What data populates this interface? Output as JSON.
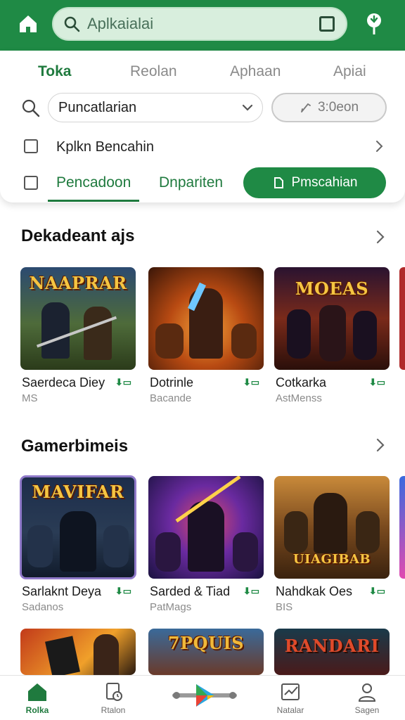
{
  "topbar": {
    "search_text": "Aplkaialai"
  },
  "tabs": [
    "Toka",
    "Reolan",
    "Aphaan",
    "Apiai"
  ],
  "filters": {
    "dropdown_value": "Puncatlarian",
    "time_value": "3:0eon",
    "checkbox_label": "Kplkn Bencahin",
    "link1": "Pencadoon",
    "link2": "Dnpariten",
    "button_label": "Pmscahian"
  },
  "sections": [
    {
      "title": "Dekadeant ajs",
      "games": [
        {
          "name": "Saerdeca Diey",
          "sub": "MS",
          "art": "NAAPRAR"
        },
        {
          "name": "Dotrinle",
          "sub": "Bacande",
          "art": ""
        },
        {
          "name": "Cotkarka",
          "sub": "AstMenss",
          "art": "MOEAS"
        }
      ]
    },
    {
      "title": "Gamerbimeis",
      "games": [
        {
          "name": "Sarlaknt Deya",
          "sub": "Sadanos",
          "art": "MAVIFAR"
        },
        {
          "name": "Sarded & Tiad",
          "sub": "PatMags",
          "art": ""
        },
        {
          "name": "Nahdkak Oes",
          "sub": "BIS",
          "art": "UIAGIBAB"
        }
      ]
    },
    {
      "games": [
        {
          "art": ""
        },
        {
          "art": "7PQUIS"
        },
        {
          "art": "RANDARI"
        }
      ]
    }
  ],
  "bottom_nav": [
    {
      "label": "Rolka",
      "icon": "home-icon",
      "active": true
    },
    {
      "label": "Rtalon",
      "icon": "document-clock-icon",
      "active": false
    },
    {
      "label": "",
      "icon": "play-store-icon",
      "active": false
    },
    {
      "label": "Natalar",
      "icon": "chart-card-icon",
      "active": false
    },
    {
      "label": "Sagen",
      "icon": "profile-icon",
      "active": false
    }
  ],
  "colors": {
    "brand_green": "#1f8a45",
    "accent_text_green": "#1f7a3e",
    "selected_outline": "#8f79c9"
  }
}
